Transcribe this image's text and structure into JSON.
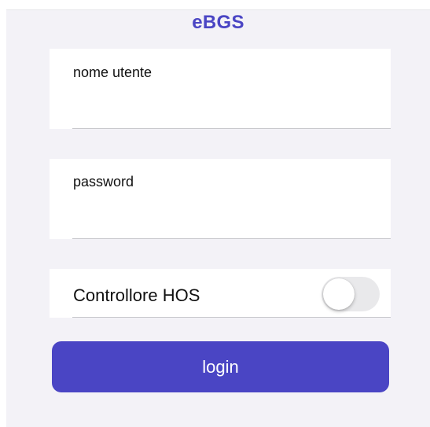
{
  "app": {
    "title": "eBGS"
  },
  "form": {
    "username": {
      "label": "nome utente",
      "value": ""
    },
    "password": {
      "label": "password",
      "value": ""
    },
    "hos_toggle": {
      "label": "Controllore HOS",
      "on": false
    },
    "login_label": "login"
  },
  "colors": {
    "accent": "#4a45c4",
    "background": "#f3f2f7",
    "toggle_off": "#e9e9eb"
  }
}
